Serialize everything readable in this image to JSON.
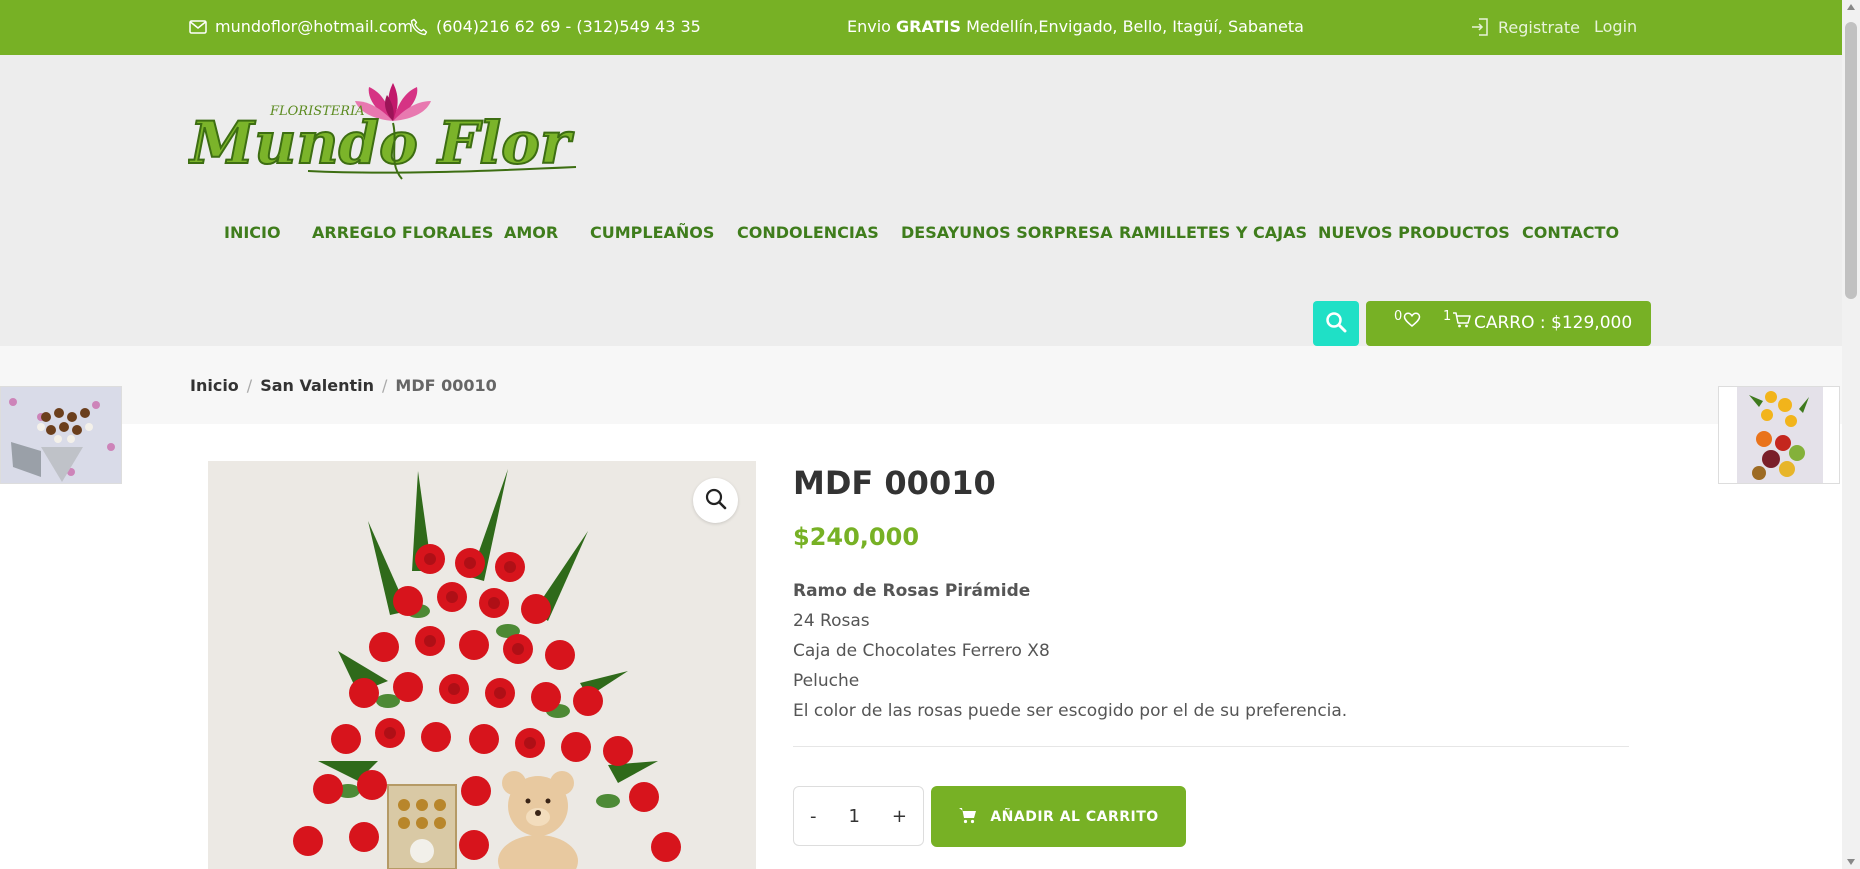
{
  "topbar": {
    "email": "mundoflor@hotmail.com",
    "phone": "(604)216 62 69 - (312)549 43 35",
    "shipping_prefix": "Envio",
    "shipping_bold": "GRATIS",
    "shipping_suffix": "Medellín,Envigado, Bello, Itagüí, Sabaneta",
    "register_label": "Registrate",
    "login_label": "Login"
  },
  "logo": {
    "brand_small": "FLORISTERIA",
    "brand_main": "Mundo Flor"
  },
  "nav": {
    "items": [
      "INICIO",
      "ARREGLO FLORALES",
      "AMOR",
      "CUMPLEAÑOS",
      "CONDOLENCIAS",
      "DESAYUNOS SORPRESA",
      "RAMILLETES Y CAJAS",
      "NUEVOS PRODUCTOS",
      "CONTACTO"
    ]
  },
  "cart": {
    "wishlist_count": "0",
    "cart_count": "1",
    "label": "CARRO : $129,000"
  },
  "breadcrumb": {
    "items": [
      "Inicio",
      "San Valentin",
      "MDF 00010"
    ],
    "separator": "/"
  },
  "product": {
    "title": "MDF 00010",
    "price": "$240,000",
    "description_title": "Ramo de Rosas Pirámide",
    "description_lines": [
      "24 Rosas",
      "Caja de Chocolates Ferrero X8",
      "Peluche",
      "El color de las rosas puede ser escogido por el de su preferencia."
    ],
    "quantity_minus": "-",
    "quantity_value": "1",
    "quantity_plus": "+",
    "add_to_cart_label": "AÑADIR AL CARRITO"
  },
  "colors": {
    "brand_green": "#77b125",
    "nav_green": "#3f7d1c",
    "search_teal": "#1fe0c6"
  }
}
